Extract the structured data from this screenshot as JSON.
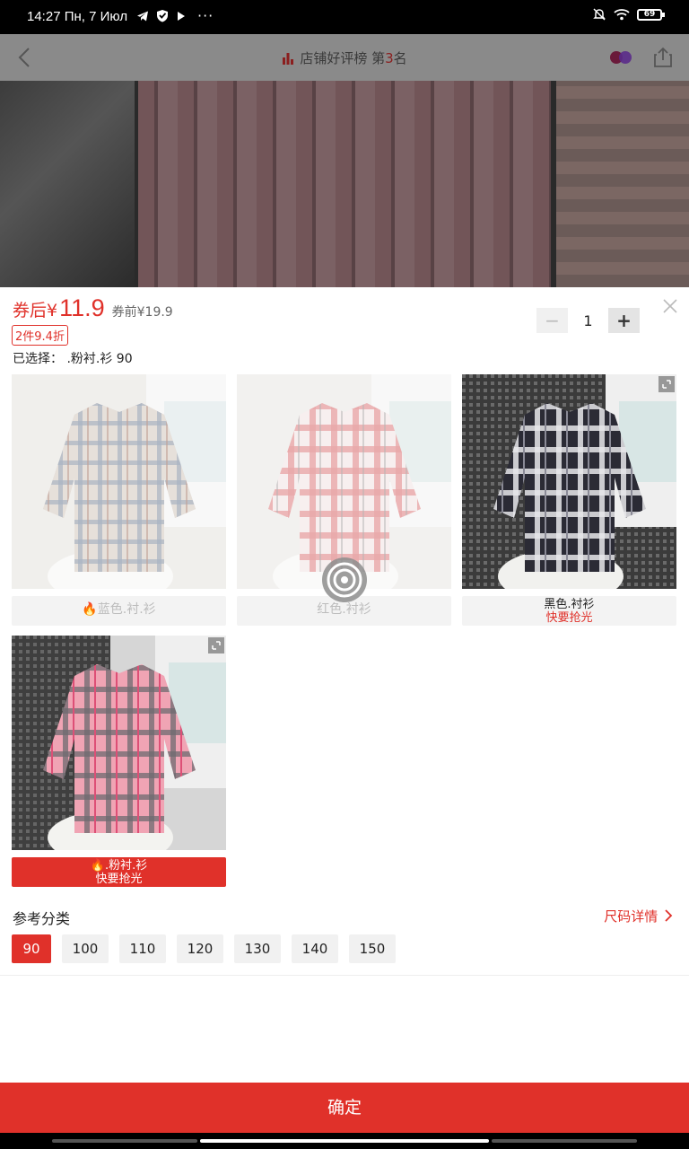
{
  "status_bar": {
    "time": "14:27 Пн, 7 Июл",
    "battery": "69"
  },
  "top_nav": {
    "rank_prefix": "店铺好评榜 第",
    "rank_number": "3",
    "rank_suffix": "名"
  },
  "product": {
    "price_label": "券后¥",
    "price": "11.9",
    "price_before": "券前¥19.9",
    "discount_tag": "2件9.4折",
    "selected_text": "已选择： .粉衬.衫 90"
  },
  "quantity": {
    "minus": "−",
    "value": "1",
    "plus": "+"
  },
  "variants": [
    {
      "name": "蓝色.衬.衫",
      "hot": "",
      "state": "disabled",
      "colors": [
        "#d8cfc6",
        "#6c7d93",
        "#a99d92"
      ]
    },
    {
      "name": "红色.衬衫",
      "hot": "",
      "state": "disabled",
      "colors": [
        "#f0e6e6",
        "#d9797a",
        "#bdbdbd"
      ]
    },
    {
      "name": "黑色.衬衫",
      "hot": "快要抢光",
      "state": "normal",
      "colors": [
        "#d9d9d9",
        "#2b2b35",
        "#f3f3f3"
      ]
    },
    {
      "name": ".粉衬.衫",
      "hot": "快要抢光",
      "state": "active",
      "colors": [
        "#f0a4b4",
        "#dd4f76",
        "#6d6a70"
      ]
    }
  ],
  "sizes": {
    "title": "参考分类",
    "detail_label": "尺码详情",
    "options": [
      "90",
      "100",
      "110",
      "120",
      "130",
      "140",
      "150"
    ],
    "selected": "90"
  },
  "confirm_label": "确定",
  "colors": {
    "accent": "#e0312a"
  }
}
